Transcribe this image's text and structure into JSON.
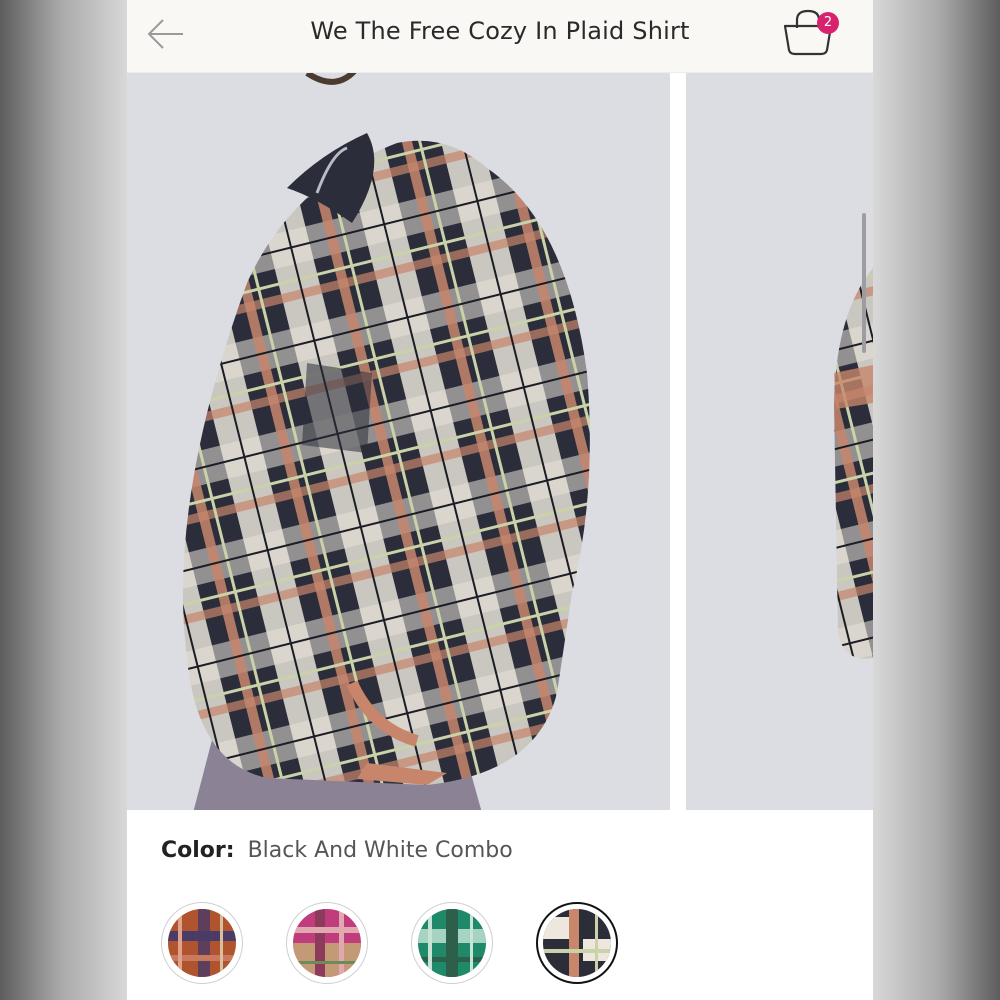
{
  "header": {
    "title": "We The Free Cozy In Plaid Shirt",
    "back_icon": "arrow-left-icon",
    "cart_icon": "shopping-bag-icon",
    "cart_count": "2",
    "badge_color": "#d8226e"
  },
  "gallery": {
    "images": [
      {
        "subject": "model wearing oversized black and white plaid waffle-knit shirt with tan patches"
      },
      {
        "subject": "partial view of next product photo showing sleeve of plaid shirt"
      }
    ]
  },
  "color_selector": {
    "label": "Color:",
    "value": "Black And White Combo",
    "swatches": [
      {
        "name": "rust plaid",
        "colors": [
          "#b0532f",
          "#4a3b67",
          "#c9795d"
        ]
      },
      {
        "name": "pink plaid",
        "colors": [
          "#c13c7d",
          "#e2a8b0",
          "#8c3b5a"
        ]
      },
      {
        "name": "green plaid",
        "colors": [
          "#1f8a6a",
          "#a6d3c2",
          "#2d5f4a"
        ]
      },
      {
        "name": "black and white plaid",
        "colors": [
          "#2b2d38",
          "#ede7dd",
          "#c8866a"
        ],
        "selected": true
      }
    ]
  }
}
